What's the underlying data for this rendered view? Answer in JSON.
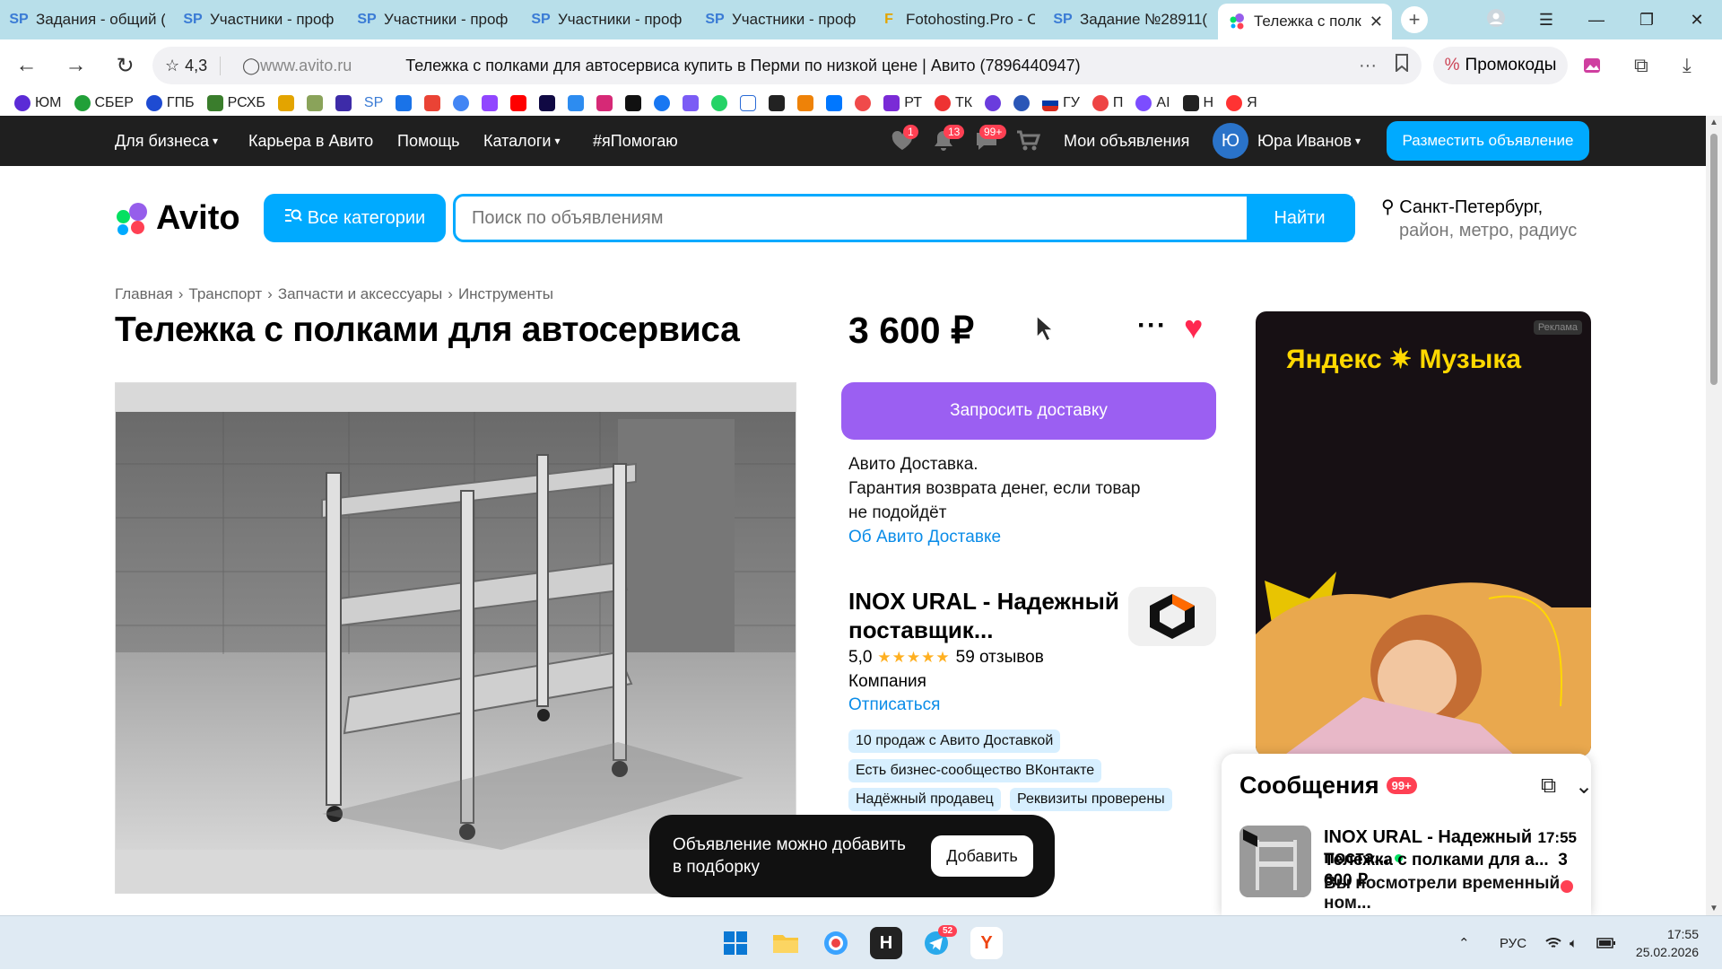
{
  "browser": {
    "tabs": [
      {
        "icon": "SP",
        "label": "Задания - общий ("
      },
      {
        "icon": "SP",
        "label": "Участники - проф"
      },
      {
        "icon": "SP",
        "label": "Участники - проф"
      },
      {
        "icon": "SP",
        "label": "Участники - проф"
      },
      {
        "icon": "SP",
        "label": "Участники - проф"
      },
      {
        "icon": "F",
        "label": "Fotohosting.Pro - C"
      },
      {
        "icon": "SP",
        "label": "Задание №28911("
      },
      {
        "icon": "avito",
        "label": "Тележка с полк"
      }
    ],
    "rating": "4,3",
    "domain": "www.avito.ru",
    "page_title": "Тележка с полками для автосервиса купить в Перми по низкой цене | Авито (7896440947)",
    "promo_label": "Промокоды",
    "bookmarks": [
      "ЮМ",
      "СБЕР",
      "ГПБ",
      "РСХБ",
      "",
      "",
      "",
      "SP",
      "",
      "",
      "",
      "",
      "",
      "",
      "",
      "",
      "",
      "",
      "",
      "",
      "",
      "",
      "",
      "",
      "",
      "РТ",
      "ТК",
      "",
      "",
      "ГУ",
      "П",
      "AI",
      "Н",
      "Я"
    ]
  },
  "avito_top": {
    "business": "Для бизнеса",
    "career": "Карьера в Авито",
    "help": "Помощь",
    "catalogs": "Каталоги",
    "ya_pomogayu": "#яПомогаю",
    "fav_badge": "1",
    "notif_badge": "13",
    "msg_badge": "99+",
    "my_ads": "Мои объявления",
    "user_initial": "Ю",
    "user_name": "Юра Иванов",
    "post_ad": "Разместить объявление"
  },
  "header": {
    "logo": "Avito",
    "all_categories": "Все категории",
    "search_placeholder": "Поиск по объявлениям",
    "find": "Найти",
    "city": "Санкт-Петербург,",
    "city_sub": "район, метро, радиус"
  },
  "breadcrumbs": [
    "Главная",
    "Транспорт",
    "Запчасти и аксессуары",
    "Инструменты"
  ],
  "listing": {
    "title": "Тележка с полками для автосервиса",
    "price": "3 600 ₽",
    "delivery_button": "Запросить доставку",
    "delivery_line1": "Авито Доставка.",
    "delivery_line2": "Гарантия возврата денег, если товар",
    "delivery_line3": "не подойдёт",
    "delivery_link": "Об Авито Доставке"
  },
  "seller": {
    "name_line1": "INOX URAL - Надежный",
    "name_line2": "поставщик...",
    "rating": "5,0",
    "stars": "★★★★★",
    "reviews": "59 отзывов",
    "type": "Компания",
    "unsubscribe": "Отписаться",
    "tags": [
      "10 продаж с Авито Доставкой",
      "Есть бизнес-сообщество ВКонтакте",
      "Надёжный продавец",
      "Реквизиты проверены"
    ]
  },
  "ad_banner": {
    "label": "Реклама",
    "brand": "Яндекс ✷ Музыка"
  },
  "toast": {
    "text": "Объявление можно добавить в подборку",
    "button": "Добавить"
  },
  "messages": {
    "title": "Сообщения",
    "badge": "99+",
    "chat_name": "INOX URAL - Надежный поста...",
    "chat_item": "Тележка с полками для а...",
    "chat_price": "3 600 ₽",
    "chat_text": "Вы посмотрели временный ном...",
    "chat_time": "17:55"
  },
  "taskbar": {
    "lang": "РУС",
    "telegram_badge": "52",
    "time": "17:55",
    "date": "25.02.2026"
  },
  "colors": {
    "avito_blue": "#00aaff",
    "delivery_purple": "#9b5ff2",
    "badge_red": "#ff4053",
    "dark_bar": "#1f1f1f"
  }
}
